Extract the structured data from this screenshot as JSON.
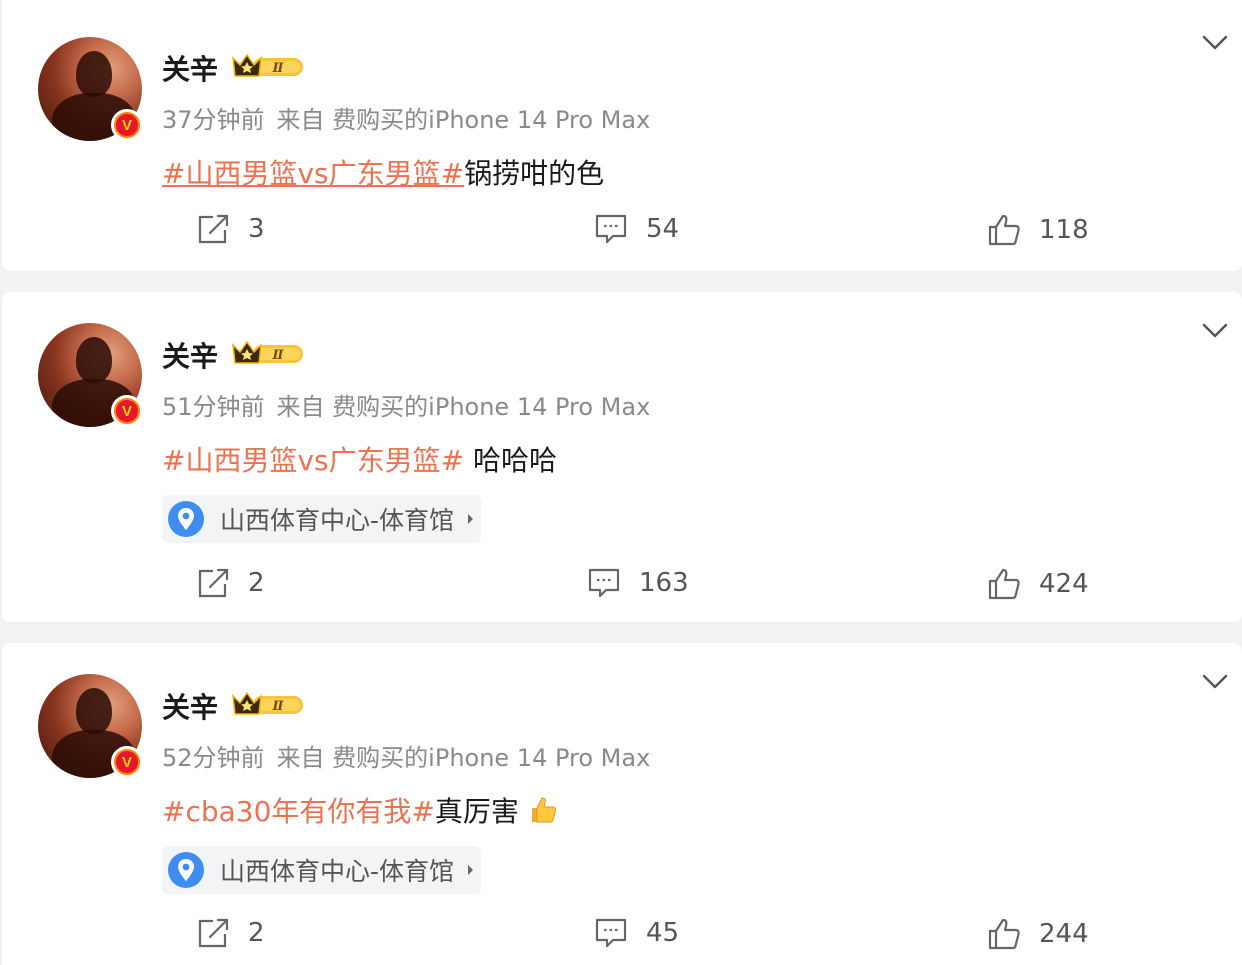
{
  "posts": [
    {
      "user": {
        "name": "关辛",
        "level_badge": "Ⅱ",
        "verified_badge": "V"
      },
      "meta": {
        "time": "37分钟前",
        "source": "来自 费购买的iPhone 14 Pro Max"
      },
      "content": {
        "topic": "#山西男篮vs广东男篮#",
        "text": "锅捞咁的色",
        "emoji": ""
      },
      "location": null,
      "actions": {
        "repost_count": "3",
        "comment_count": "54",
        "like_count": "118"
      }
    },
    {
      "user": {
        "name": "关辛",
        "level_badge": "Ⅱ",
        "verified_badge": "V"
      },
      "meta": {
        "time": "51分钟前",
        "source": "来自 费购买的iPhone 14 Pro Max"
      },
      "content": {
        "topic": "#山西男篮vs广东男篮#",
        "text": " 哈哈哈",
        "emoji": ""
      },
      "location": "山西体育中心-体育馆",
      "actions": {
        "repost_count": "2",
        "comment_count": "163",
        "like_count": "424"
      }
    },
    {
      "user": {
        "name": "关辛",
        "level_badge": "Ⅱ",
        "verified_badge": "V"
      },
      "meta": {
        "time": "52分钟前",
        "source": "来自 费购买的iPhone 14 Pro Max"
      },
      "content": {
        "topic": "#cba30年有你有我#",
        "text": "真厉害",
        "emoji": "thumbs-up"
      },
      "location": "山西体育中心-体育馆",
      "actions": {
        "repost_count": "2",
        "comment_count": "45",
        "like_count": "244"
      }
    }
  ],
  "icons": {
    "more": "chevron-down-icon",
    "repost": "repost-icon",
    "comment": "comment-icon",
    "like": "like-icon",
    "location": "location-pin-icon",
    "level": "crown-level-icon",
    "verified": "verified-v-icon"
  },
  "colors": {
    "topic": "#eb7350",
    "meta_text": "#8a8a8a",
    "location_pin": "#3f8df1",
    "verified_badge": "#ff8200",
    "crown": "#f5b400",
    "background": "#f2f2f2"
  }
}
